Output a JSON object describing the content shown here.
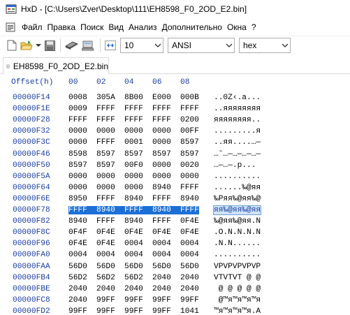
{
  "window": {
    "title": "HxD - [C:\\Users\\Zver\\Desktop\\111\\EH8598_F0_2OD_E2.bin]"
  },
  "menu": {
    "items": [
      "Файл",
      "Правка",
      "Поиск",
      "Вид",
      "Анализ",
      "Дополнительно",
      "Окна",
      "?"
    ]
  },
  "toolbar": {
    "bytes_per_row": "10",
    "charset": "ANSI",
    "display_mode": "hex"
  },
  "tab": {
    "label": "EH8598_F0_2OD_E2.bin"
  },
  "hex_view": {
    "offset_header": "Offset(h)",
    "column_headers": [
      "00",
      "02",
      "04",
      "06",
      "08"
    ],
    "selected_row": 10,
    "rows": [
      {
        "offset": "00000F14",
        "words": [
          "0008",
          "305A",
          "8B00",
          "E000",
          "000B"
        ],
        "text": "..0Z‹.a..."
      },
      {
        "offset": "00000F1E",
        "words": [
          "0009",
          "FFFF",
          "FFFF",
          "FFFF",
          "FFFF"
        ],
        "text": "..яяяяяяяя"
      },
      {
        "offset": "00000F28",
        "words": [
          "FFFF",
          "FFFF",
          "FFFF",
          "FFFF",
          "0200"
        ],
        "text": "яяяяяяяя.."
      },
      {
        "offset": "00000F32",
        "words": [
          "0000",
          "0000",
          "0000",
          "0000",
          "00FF"
        ],
        "text": ".........я"
      },
      {
        "offset": "00000F3C",
        "words": [
          "0000",
          "FFFF",
          "0001",
          "0000",
          "8597"
        ],
        "text": "..яя....…—"
      },
      {
        "offset": "00000F46",
        "words": [
          "8598",
          "8597",
          "8597",
          "8597",
          "8597"
        ],
        "text": "…˜…—…—…—…—"
      },
      {
        "offset": "00000F50",
        "words": [
          "8597",
          "8597",
          "00F0",
          "0000",
          "0020"
        ],
        "text": "…—…—.р..."
      },
      {
        "offset": "00000F5A",
        "words": [
          "0000",
          "0000",
          "0000",
          "0000",
          "0000"
        ],
        "text": ".........."
      },
      {
        "offset": "00000F64",
        "words": [
          "0000",
          "0000",
          "0000",
          "8940",
          "FFFF"
        ],
        "text": "......‰@яя"
      },
      {
        "offset": "00000F6E",
        "words": [
          "8950",
          "FFFF",
          "8940",
          "FFFF",
          "8940"
        ],
        "text": "‰Pяя‰@яя‰@"
      },
      {
        "offset": "00000F78",
        "words": [
          "FFFF",
          "8940",
          "FFFF",
          "8940",
          "FFFF"
        ],
        "text": "яя‰@яя‰@яя"
      },
      {
        "offset": "00000F82",
        "words": [
          "8940",
          "FFFF",
          "8940",
          "FFFF",
          "0F4E"
        ],
        "text": "‰@яя‰@яя.N"
      },
      {
        "offset": "00000F8C",
        "words": [
          "0F4F",
          "0F4E",
          "0F4E",
          "0F4E",
          "0F4E"
        ],
        "text": ".O.N.N.N.N"
      },
      {
        "offset": "00000F96",
        "words": [
          "0F4E",
          "0F4E",
          "0004",
          "0004",
          "0004"
        ],
        "text": ".N.N......"
      },
      {
        "offset": "00000FA0",
        "words": [
          "0004",
          "0004",
          "0004",
          "0004",
          "0004"
        ],
        "text": ".........."
      },
      {
        "offset": "00000FAA",
        "words": [
          "56D0",
          "56D0",
          "56D0",
          "56D0",
          "56D0"
        ],
        "text": "VРVРVРVРVР"
      },
      {
        "offset": "00000FB4",
        "words": [
          "56D2",
          "56D2",
          "56D2",
          "2040",
          "2040"
        ],
        "text": "VТVТVТ @ @"
      },
      {
        "offset": "00000FBE",
        "words": [
          "2040",
          "2040",
          "2040",
          "2040",
          "2040"
        ],
        "text": " @ @ @ @ @"
      },
      {
        "offset": "00000FC8",
        "words": [
          "2040",
          "99FF",
          "99FF",
          "99FF",
          "99FF"
        ],
        "text": " @™я™я™я™я"
      },
      {
        "offset": "00000FD2",
        "words": [
          "99FF",
          "99FF",
          "99FF",
          "99FF",
          "1041"
        ],
        "text": "™я™я™я™я.A"
      }
    ]
  },
  "colors": {
    "offset_blue": "#1a3ea3",
    "selection_blue": "#1b6fd6",
    "text_selection_bg": "#cfe3f7"
  },
  "icons": [
    "hxd-app-icon",
    "menu-grip-icon",
    "new-file-icon",
    "open-folder-icon",
    "dropdown-arrow-icon",
    "save-icon",
    "ram-icon",
    "disk-icon",
    "bytes-per-row-icon",
    "chevron-down-icon",
    "file-tab-icon"
  ]
}
